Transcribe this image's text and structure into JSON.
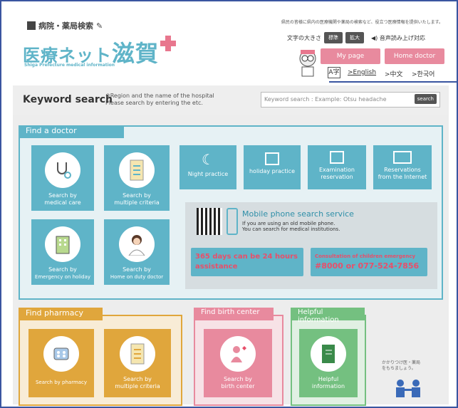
{
  "header": {
    "brand_top": "病院・薬局検索",
    "brand_name_small": "医療ネット",
    "brand_name_big": "滋賀",
    "brand_sub": "Shiga Prefecture medical information",
    "note": "県民の皆様に県内の医療機関や薬局の検索など、役立つ医療情報を提供いたします。",
    "font_size_label": "文字の大きさ",
    "font_standard": "標準",
    "font_large": "拡大",
    "audio_label": "音声読み上げ対応",
    "my_page": "My page",
    "home_doctor": "Home doctor",
    "lang_icon": "A字",
    "lang_english": ">English",
    "lang_chinese": ">中文",
    "lang_korean": ">한국어"
  },
  "search": {
    "title": "Keyword search",
    "note_line1": "※Region and the name of the hospital",
    "note_line2": "Please search by entering the etc.",
    "placeholder": "Keyword search : Example: Otsu headache",
    "button": "search"
  },
  "doctor": {
    "tab": "Find a doctor",
    "tiles": [
      {
        "line1": "Search by",
        "line2": "medical care",
        "icon": "stethoscope-icon"
      },
      {
        "line1": "Search by",
        "line2": "multiple criteria",
        "icon": "checklist-icon"
      },
      {
        "line1": "Search by",
        "line2": "Emergency on holiday",
        "icon": "hospital-icon"
      },
      {
        "line1": "Search by",
        "line2": "Home on duty doctor",
        "icon": "doctor-icon"
      }
    ],
    "small_tiles": [
      {
        "line1": "Night practice",
        "line2": "",
        "icon": "moon-icon"
      },
      {
        "line1": "holiday practice",
        "line2": "",
        "icon": "calendar-check-icon"
      },
      {
        "line1": "Examination",
        "line2": "reservation",
        "icon": "calendar-icon"
      },
      {
        "line1": "Reservations",
        "line2": "from the Internet",
        "icon": "monitor-icon"
      }
    ],
    "mobile_title": "Mobile phone search service",
    "mobile_line1": "If you are using an old mobile phone.",
    "mobile_line2": "You can search for medical institutions.",
    "alert1_line1": "365 days can be 24 hours",
    "alert1_line2": "assistance",
    "alert2_line1": "Consultation of children emergency",
    "alert2_line2": "#8000 or 077-524-7856"
  },
  "pharmacy": {
    "tab": "Find pharmacy",
    "tiles": [
      {
        "line1": "Search by pharmacy",
        "line2": "",
        "icon": "pills-icon"
      },
      {
        "line1": "Search by",
        "line2": "multiple criteria",
        "icon": "checklist-icon"
      }
    ]
  },
  "birth": {
    "tab": "Find birth center",
    "tile": {
      "line1": "Search by",
      "line2": "birth center",
      "icon": "mother-baby-icon"
    }
  },
  "help": {
    "tab": "Helpful information",
    "tile": {
      "line1": "Helpful",
      "line2": "information",
      "icon": "book-icon"
    }
  },
  "side_text_line1": "かかりつけ医・薬局",
  "side_text_line2": "をもちましょう。",
  "colors": {
    "teal": "#5fb4c8",
    "pink": "#e88a9e",
    "orange": "#e0a63c",
    "green": "#74c080",
    "alert": "#e84f6a"
  }
}
